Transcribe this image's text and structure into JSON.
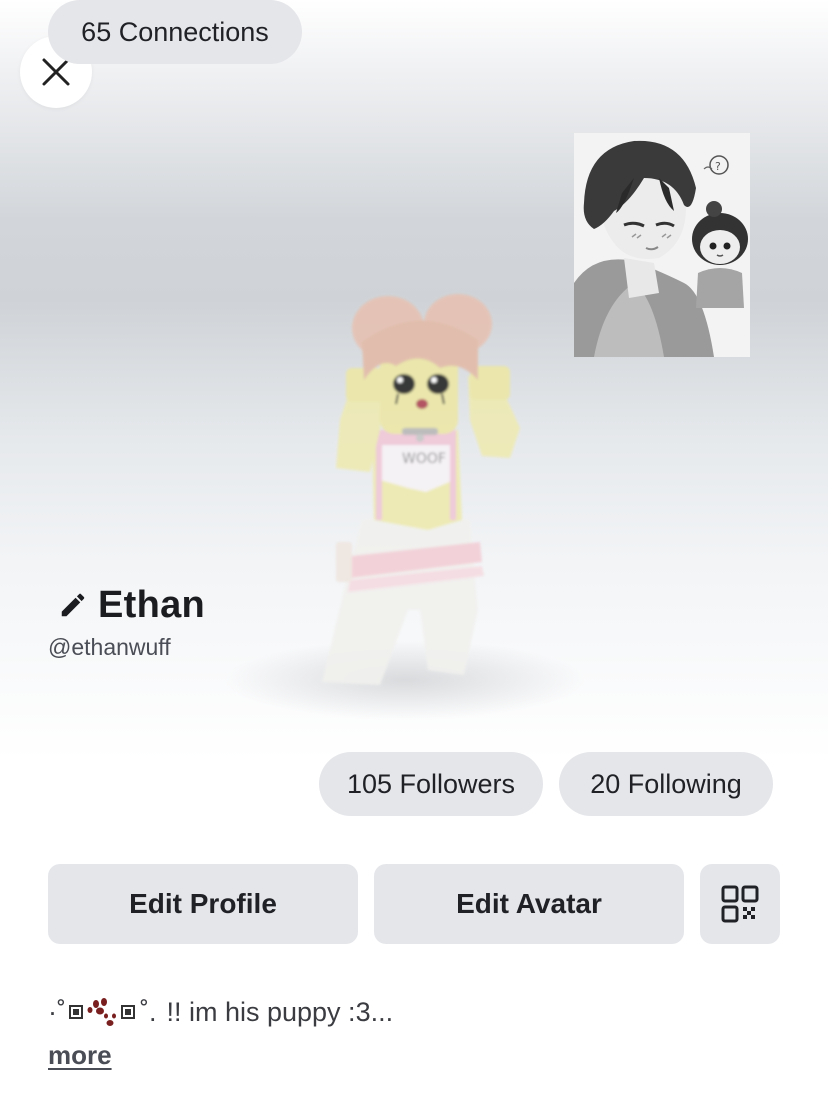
{
  "profile": {
    "display_name": "Ethan",
    "username": "@ethanwuff",
    "bio": "!! im his puppy :3...",
    "bio_prefix_decoration": "·˚",
    "bio_suffix_decoration": "˚.",
    "more_label": "more",
    "avatar_shirt_text": "WOOF"
  },
  "stats": {
    "connections_label": "65 Connections",
    "followers_label": "105 Followers",
    "following_label": "20 Following"
  },
  "actions": {
    "edit_profile_label": "Edit Profile",
    "edit_avatar_label": "Edit Avatar"
  },
  "icons": {
    "close": "close-icon",
    "edit": "pencil-icon",
    "qr": "qr-code-icon",
    "bio_decoration": "paw-icon"
  },
  "colors": {
    "pill_bg": "#e5e6ea",
    "text_primary": "#1f2126",
    "text_secondary": "#4a4d55",
    "paw": "#7a1f1f"
  }
}
